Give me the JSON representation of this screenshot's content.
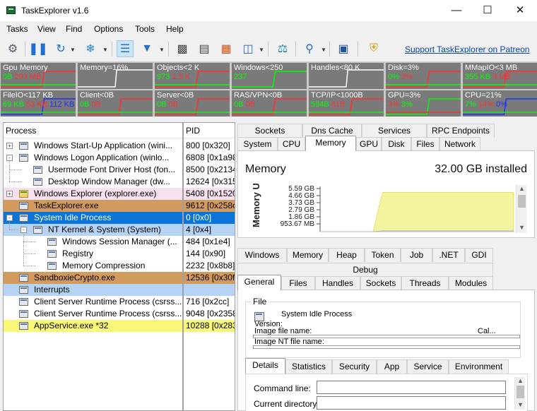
{
  "window": {
    "title": "TaskExplorer v1.6",
    "minimize_icon": "minimize-icon",
    "maximize_icon": "maximize-icon",
    "close_icon": "close-icon"
  },
  "menu": [
    "Tasks",
    "View",
    "Find",
    "Options",
    "Tools",
    "Help"
  ],
  "toolbar": {
    "patreon_link": "Support TaskExplorer on Patreon",
    "icons": [
      "services-gears-icon",
      "pause-icon",
      "refresh-icon",
      "snowflake-freeze-icon",
      "tree-view-icon",
      "filter-icon",
      "terminal-window-icon",
      "window-list-icon",
      "firewall-icon",
      "process-window-icon",
      "monitor-graph-icon",
      "search-icon",
      "console-icon",
      "shield-icon"
    ]
  },
  "graphs": [
    {
      "label": "Gpu Memory",
      "values": [
        {
          "t": "0B",
          "c": "green"
        },
        {
          "t": "293 MB",
          "c": "red"
        }
      ]
    },
    {
      "label": "Memory=16%",
      "values": []
    },
    {
      "label": "Objects<2 K",
      "values": [
        {
          "t": "973",
          "c": "green"
        },
        {
          "t": "1.5 K",
          "c": "red"
        }
      ]
    },
    {
      "label": "Windows<250",
      "values": [
        {
          "t": "237",
          "c": "green"
        }
      ]
    },
    {
      "label": "Handles<80 K",
      "values": []
    },
    {
      "label": "Disk=3%",
      "values": [
        {
          "t": "0%",
          "c": "green"
        },
        {
          "t": "3%",
          "c": "red"
        }
      ]
    },
    {
      "label": "MMapIO<3 MB",
      "values": [
        {
          "t": "355 KB",
          "c": "green"
        },
        {
          "t": "3 MB",
          "c": "red"
        }
      ]
    },
    {
      "label": "FileIO<117 KB",
      "values": [
        {
          "t": "69 KB",
          "c": "green"
        },
        {
          "t": "53 KB",
          "c": "red"
        },
        {
          "t": "112 KB",
          "c": "blue"
        }
      ]
    },
    {
      "label": "Client<0B",
      "values": [
        {
          "t": "0B",
          "c": "green"
        },
        {
          "t": "0B",
          "c": "red"
        }
      ]
    },
    {
      "label": "Server<0B",
      "values": [
        {
          "t": "0B",
          "c": "green"
        },
        {
          "t": "0B",
          "c": "red"
        }
      ]
    },
    {
      "label": "RAS/VPN<0B",
      "values": [
        {
          "t": "0B",
          "c": "green"
        },
        {
          "t": "0B",
          "c": "red"
        }
      ]
    },
    {
      "label": "TCP/IP<1000B",
      "values": [
        {
          "t": "594B",
          "c": "green"
        },
        {
          "t": "41B",
          "c": "red"
        }
      ]
    },
    {
      "label": "GPU=3%",
      "values": [
        {
          "t": "3%",
          "c": "red"
        },
        {
          "t": "3%",
          "c": "green"
        }
      ]
    },
    {
      "label": "CPU=21%",
      "values": [
        {
          "t": "7%",
          "c": "green"
        },
        {
          "t": "14%",
          "c": "red"
        },
        {
          "t": "0%",
          "c": "blue"
        }
      ]
    }
  ],
  "tree": {
    "header_process": "Process",
    "header_pid": "PID",
    "rows": [
      {
        "name": "Windows Start-Up Application (wini...",
        "pid": "800 [0x320]",
        "level": 0,
        "expander": "+",
        "hl": ""
      },
      {
        "name": "Windows Logon Application (winlo...",
        "pid": "6808 [0x1a98",
        "level": 0,
        "expander": "-",
        "hl": ""
      },
      {
        "name": "Usermode Font Driver Host (fon...",
        "pid": "8500 [0x2134",
        "level": 1,
        "expander": "",
        "hl": ""
      },
      {
        "name": "Desktop Window Manager (dw...",
        "pid": "12624 [0x315",
        "level": 1,
        "expander": "",
        "hl": ""
      },
      {
        "name": "Windows Explorer (explorer.exe)",
        "pid": "5408 [0x1520",
        "level": 0,
        "expander": "+",
        "hl": "pink",
        "icon": "yellow"
      },
      {
        "name": "TaskExplorer.exe",
        "pid": "9612 [0x258c",
        "level": 0,
        "expander": "",
        "hl": "orange"
      },
      {
        "name": "System Idle Process",
        "pid": "0 [0x0]",
        "level": 0,
        "expander": "-",
        "hl": "sel"
      },
      {
        "name": "NT Kernel & System (System)",
        "pid": "4 [0x4]",
        "level": 1,
        "expander": "-",
        "hl": "blue"
      },
      {
        "name": "Windows Session Manager (...",
        "pid": "484 [0x1e4]",
        "level": 2,
        "expander": "",
        "hl": ""
      },
      {
        "name": "Registry",
        "pid": "144 [0x90]",
        "level": 2,
        "expander": "",
        "hl": ""
      },
      {
        "name": "Memory Compression",
        "pid": "2232 [0x8b8]",
        "level": 2,
        "expander": "",
        "hl": ""
      },
      {
        "name": "SandboxieCrypto.exe",
        "pid": "12536 [0x30f",
        "level": 0,
        "expander": "",
        "hl": "orange"
      },
      {
        "name": "Interrupts",
        "pid": "",
        "level": 0,
        "expander": "",
        "hl": "blue"
      },
      {
        "name": "Client Server Runtime Process (csrss...",
        "pid": "716 [0x2cc]",
        "level": 0,
        "expander": "",
        "hl": ""
      },
      {
        "name": "Client Server Runtime Process (csrss...",
        "pid": "9048 [0x2358",
        "level": 0,
        "expander": "",
        "hl": ""
      },
      {
        "name": "AppService.exe *32",
        "pid": "10288 [0x283",
        "level": 0,
        "expander": "",
        "hl": "yellow"
      }
    ]
  },
  "system_tabs_row1": [
    "Sockets",
    "Dns Cache",
    "Services",
    "RPC Endpoints"
  ],
  "system_tabs_row2": [
    "System",
    "CPU",
    "Memory",
    "GPU",
    "Disk",
    "Files",
    "Network"
  ],
  "system_tab_selected": "Memory",
  "memory": {
    "title": "Memory",
    "installed": "32.00 GB installed",
    "axis_title": "Memory Usage",
    "chart_data": {
      "type": "area",
      "ylabel": "Memory Usage",
      "y_ticks": [
        "5.59 GB",
        "4.66 GB",
        "3.73 GB",
        "2.79 GB",
        "1.86 GB",
        "953.67 MB"
      ],
      "series": [
        {
          "color": "#f3f3a0",
          "values": [
            0,
            0,
            0,
            0,
            0,
            5.2,
            5.2,
            5.2,
            5.2,
            5.2,
            5.2,
            5.2,
            5.2,
            5.2,
            5.2,
            5.2,
            5.2,
            5.2,
            5.2,
            5.2
          ]
        },
        {
          "color": "#e6e6e6",
          "values": [
            0,
            0,
            0,
            0,
            0,
            0.1,
            0.1,
            0.1,
            0.1,
            0.1,
            0.1,
            0.1,
            0.1,
            0.1,
            0.1,
            0.1,
            0.1,
            0.1,
            0.1,
            0.1
          ]
        }
      ],
      "ylim": [
        0,
        6.0
      ]
    }
  },
  "process_tabs_row1": [
    "Windows",
    "Memory",
    "Heap",
    "Token",
    "Job",
    ".NET",
    "GDI"
  ],
  "process_tabs_row2": [
    "Debug"
  ],
  "process_tabs_row3": [
    "General",
    "Files",
    "Handles",
    "Sockets",
    "Threads",
    "Modules"
  ],
  "process_tab_selected": "General",
  "general": {
    "group_title": "File",
    "process_name": "System Idle Process",
    "version_label": "Version:",
    "image_file_label": "Image file name:",
    "image_nt_label": "Image NT file name:",
    "company_fragment": "Cal..."
  },
  "details_tabs": [
    "Details",
    "Statistics",
    "Security",
    "App",
    "Service",
    "Environment"
  ],
  "details_tab_selected": "Details",
  "details": {
    "command_line_label": "Command line:",
    "current_dir_label": "Current directory:",
    "command_line_value": "",
    "current_dir_value": ""
  }
}
